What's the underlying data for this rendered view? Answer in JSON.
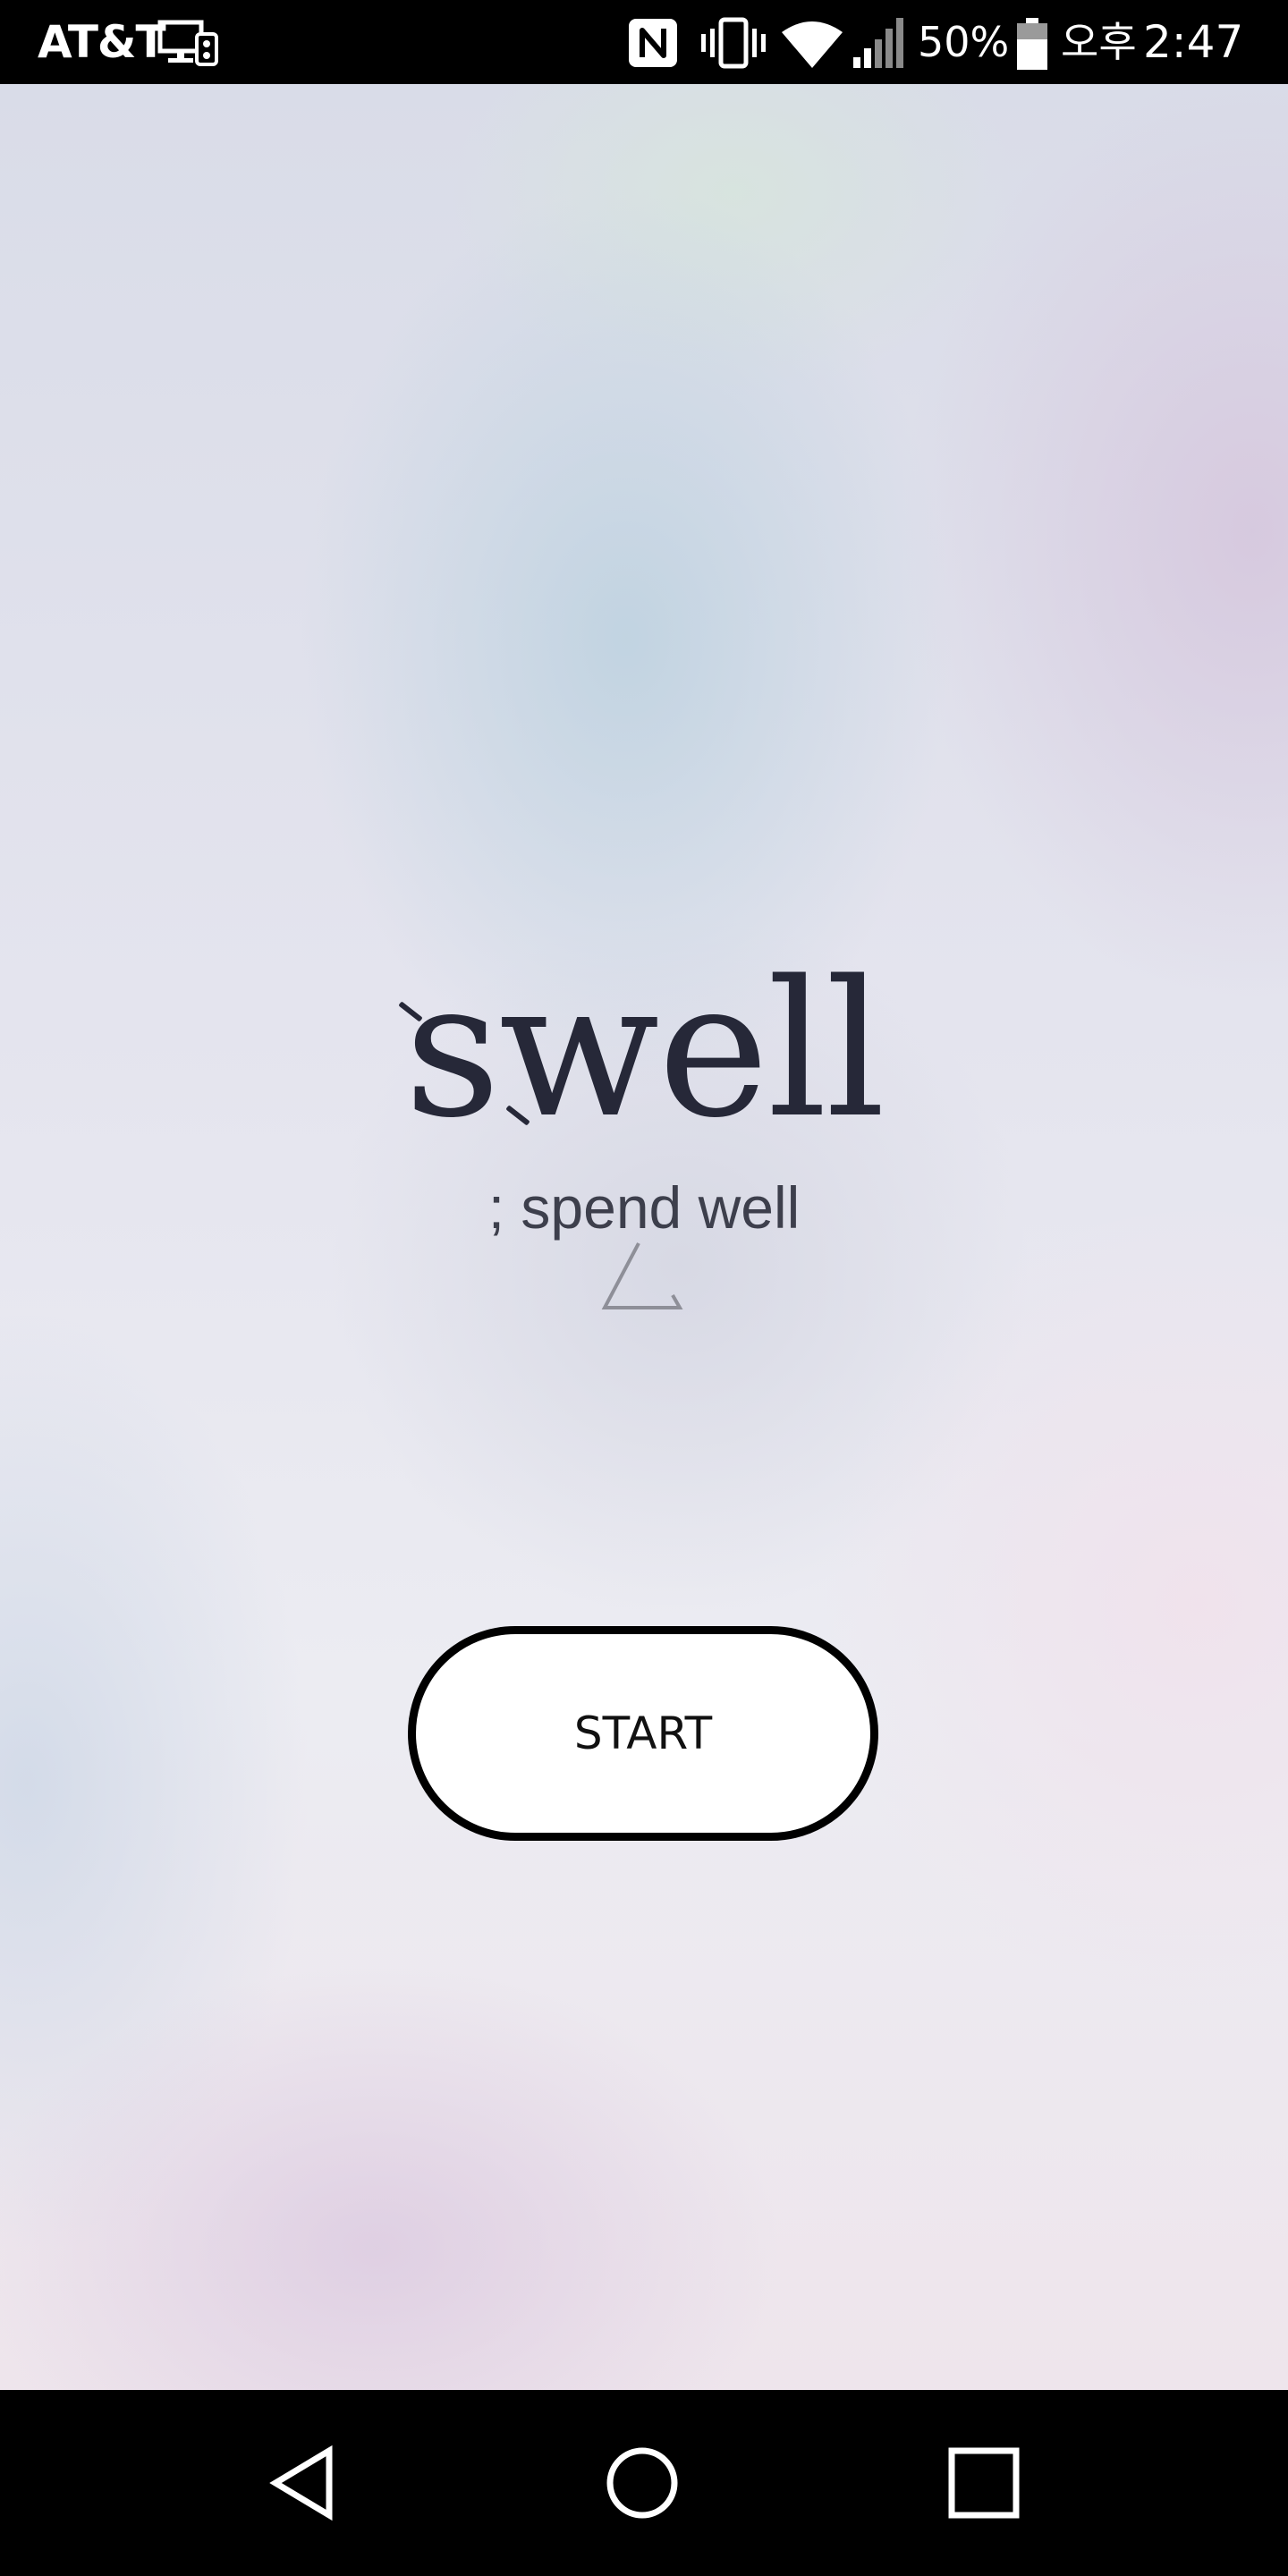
{
  "status_bar": {
    "carrier": "AT&T",
    "battery_percent": "50%",
    "ampm": "오후",
    "time": "2:47",
    "icons": [
      "screen-cast-icon",
      "nfc-icon",
      "vibrate-icon",
      "wifi-icon",
      "cell-signal-icon",
      "battery-icon"
    ]
  },
  "app": {
    "logo": "swell",
    "tagline": "; spend well",
    "start_label": "START",
    "icons": [
      "triangle-icon"
    ]
  },
  "nav_bar": {
    "icons": [
      "back-icon",
      "home-icon",
      "recents-icon"
    ]
  },
  "colors": {
    "logo": "#262838",
    "tagline": "#3d3f4c",
    "button_border": "#000000",
    "button_fill": "#ffffff",
    "bars": "#000000"
  }
}
